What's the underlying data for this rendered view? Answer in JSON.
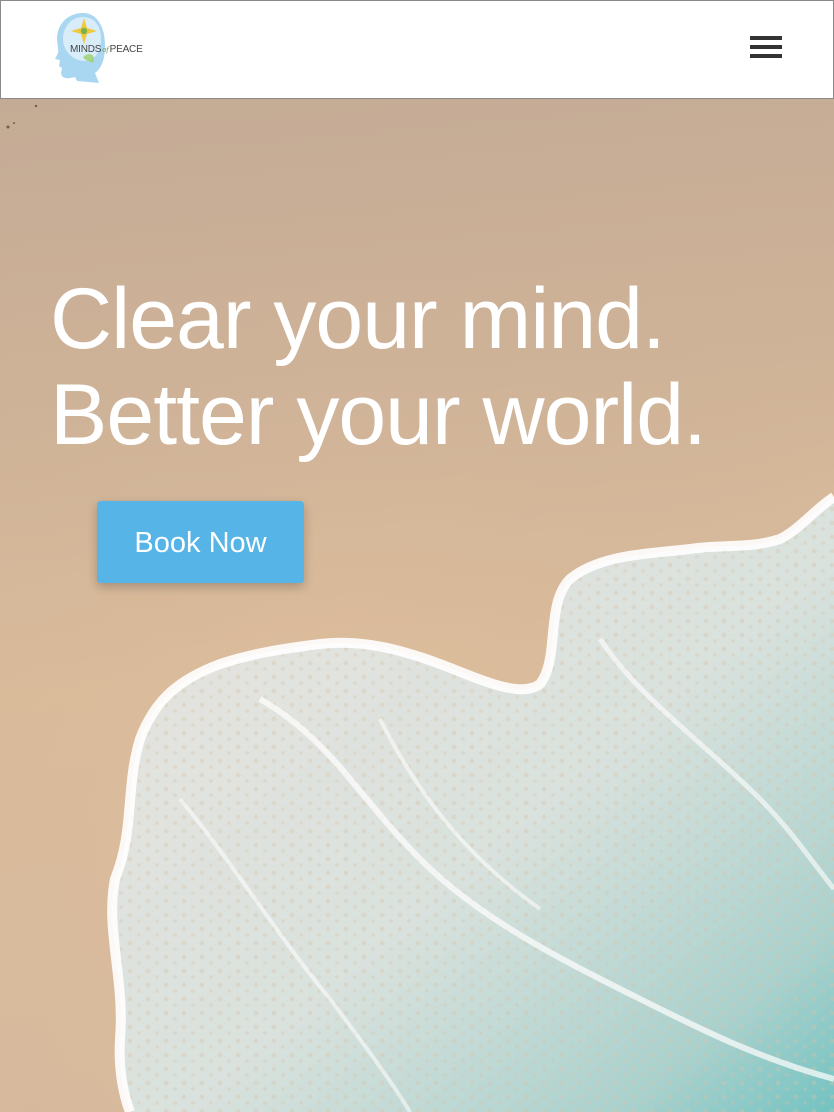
{
  "header": {
    "logo": {
      "name_left": "MINDS",
      "name_mid": "of",
      "name_right": "PEACE",
      "colors": {
        "head": "#7cc3e8",
        "star": "#e8c53a",
        "leaf": "#7db24a"
      }
    },
    "menu_icon": "hamburger-icon"
  },
  "hero": {
    "headline_line1": "Clear your mind.",
    "headline_line2": "Better your world.",
    "cta_label": "Book Now",
    "cta_color": "#56b4e6",
    "background": "beach-sand-wave"
  }
}
